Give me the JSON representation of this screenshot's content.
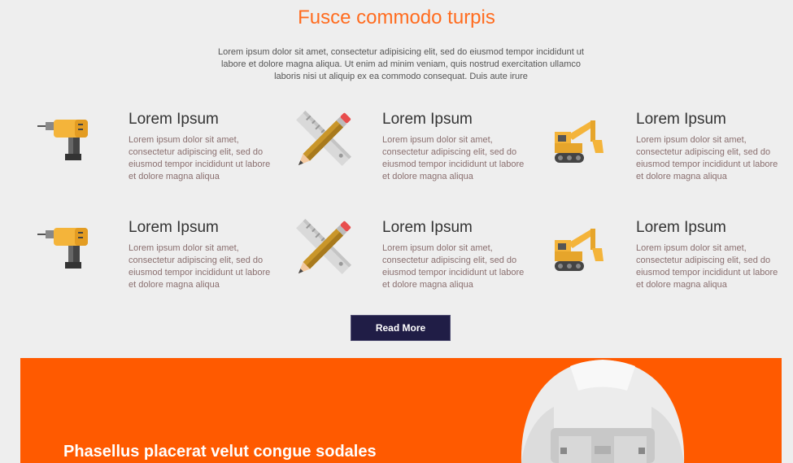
{
  "section": {
    "title": "Fusce commodo turpis",
    "intro": "Lorem ipsum dolor sit amet, consectetur adipisicing elit, sed do eiusmod tempor incididunt ut labore et dolore magna aliqua. Ut enim ad minim veniam, quis nostrud exercitation ullamco laboris nisi ut aliquip ex ea commodo consequat. Duis aute irure"
  },
  "features": [
    {
      "icon": "drill-icon",
      "title": "Lorem Ipsum",
      "text": "Lorem ipsum dolor sit amet, consectetur adipiscing elit, sed do eiusmod tempor incididunt ut labore et dolore magna aliqua"
    },
    {
      "icon": "pencil-ruler-icon",
      "title": "Lorem Ipsum",
      "text": "Lorem ipsum dolor sit amet, consectetur adipiscing elit, sed do eiusmod tempor incididunt ut labore et dolore magna aliqua"
    },
    {
      "icon": "excavator-icon",
      "title": "Lorem Ipsum",
      "text": "Lorem ipsum dolor sit amet, consectetur adipiscing elit, sed do eiusmod tempor incididunt ut labore et dolore magna aliqua"
    },
    {
      "icon": "drill-icon",
      "title": "Lorem Ipsum",
      "text": "Lorem ipsum dolor sit amet, consectetur adipiscing elit, sed do eiusmod tempor incididunt ut labore et dolore magna aliqua"
    },
    {
      "icon": "pencil-ruler-icon",
      "title": "Lorem Ipsum",
      "text": "Lorem ipsum dolor sit amet, consectetur adipiscing elit, sed do eiusmod tempor incididunt ut labore et dolore magna aliqua"
    },
    {
      "icon": "excavator-icon",
      "title": "Lorem Ipsum",
      "text": "Lorem ipsum dolor sit amet, consectetur adipiscing elit, sed do eiusmod tempor incididunt ut labore et dolore magna aliqua"
    }
  ],
  "read_more": {
    "label": "Read More"
  },
  "banner": {
    "title": "Phasellus placerat velut congue sodales",
    "image_icon": "hard-hat-icon"
  },
  "colors": {
    "accent": "#ff6c1f",
    "banner_bg": "#ff5a00",
    "button_bg": "#201d46",
    "tool_yellow": "#f4b43a"
  }
}
